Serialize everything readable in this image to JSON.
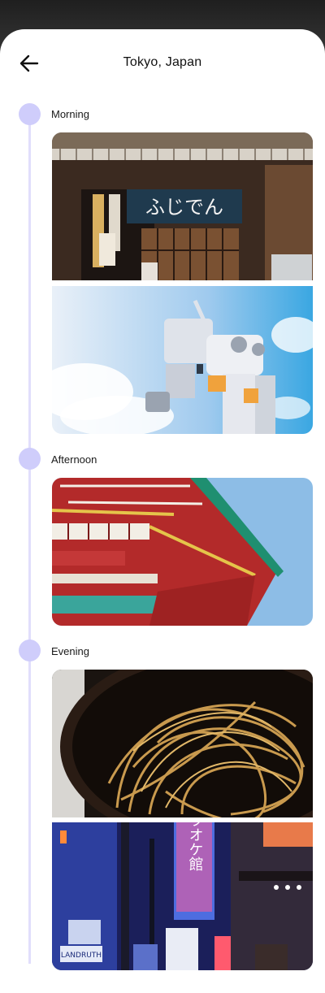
{
  "header": {
    "title": "Tokyo, Japan",
    "back_icon": "arrow-left-icon"
  },
  "accent_color": "#cfcdfb",
  "timeline": [
    {
      "label": "Morning",
      "photos": [
        "restaurant-storefront-photo",
        "robot-statue-photo"
      ]
    },
    {
      "label": "Afternoon",
      "photos": [
        "temple-roof-photo"
      ]
    },
    {
      "label": "Evening",
      "photos": [
        "noodles-bowl-photo",
        "neon-street-photo"
      ]
    }
  ],
  "photo_text": {
    "shop_sign": "ふじでん",
    "neon_sign": "ラオケ館",
    "street_sign": "LANDRUTH"
  }
}
